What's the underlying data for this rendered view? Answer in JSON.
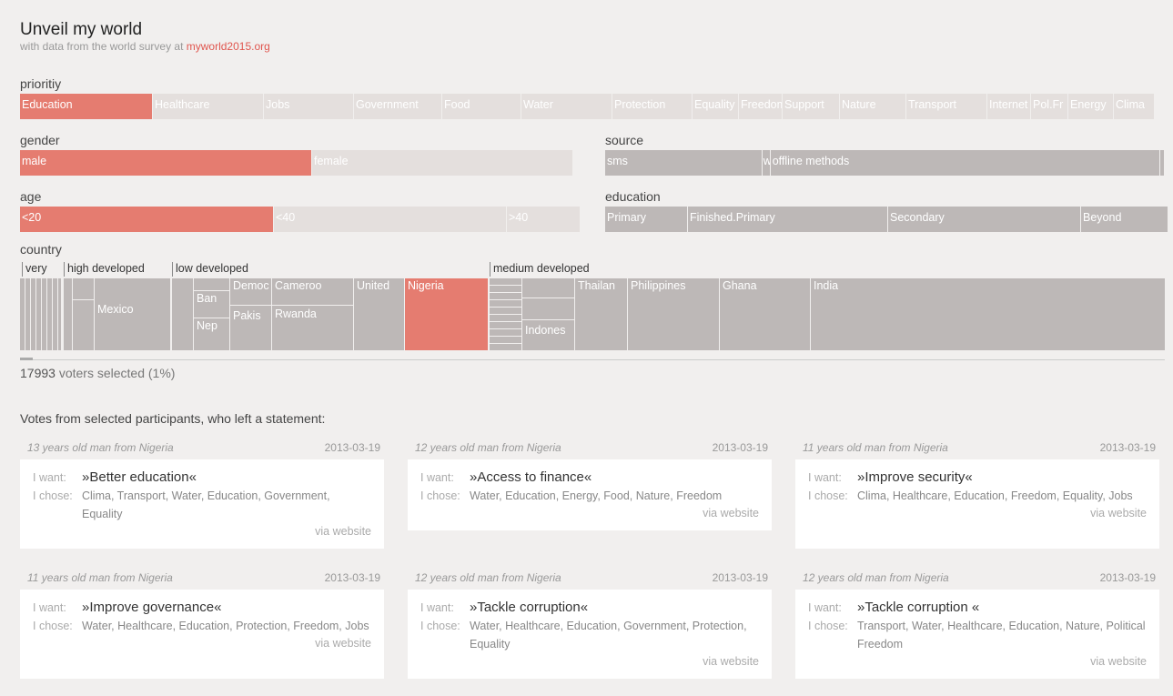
{
  "header": {
    "title": "Unveil my world",
    "subtitle_prefix": "with data from the world survey at ",
    "subtitle_link": "myworld2015.org"
  },
  "priority": {
    "label": "prioritiy",
    "items": [
      "Education",
      "Healthcare",
      "Jobs",
      "Government",
      "Food",
      "Water",
      "Protection",
      "Equality",
      "Freedom",
      "Support",
      "Nature",
      "Transport",
      "Internet",
      "Pol.Fr",
      "Energy",
      "Clima"
    ],
    "selected": "Education"
  },
  "gender": {
    "label": "gender",
    "items": [
      "male",
      "female"
    ],
    "selected": "male"
  },
  "age": {
    "label": "age",
    "items": [
      "<20",
      "<40",
      ">40"
    ],
    "selected": "<20"
  },
  "source": {
    "label": "source",
    "items": [
      "sms",
      "w",
      "offline methods",
      ""
    ]
  },
  "education": {
    "label": "education",
    "items": [
      "Primary",
      "Finished.Primary",
      "Secondary",
      "Beyond"
    ]
  },
  "country": {
    "label": "country",
    "groups": [
      "very",
      "high developed",
      "low developed",
      "medium developed"
    ],
    "cells": [
      "Mexico",
      "Ban",
      "Nep",
      "Democ",
      "Pakis",
      "Cameroo",
      "Rwanda",
      "United",
      "Nigeria",
      "Indones",
      "Thailan",
      "Philippines",
      "Ghana",
      "India"
    ],
    "selected": "Nigeria"
  },
  "selection": {
    "count": "17993",
    "text": " voters selected (1%)"
  },
  "votes": {
    "heading": "Votes from selected participants, who left a statement:",
    "want_label": "I want:",
    "chose_label": "I chose:",
    "cards": [
      {
        "who": "13 years old man from Nigeria",
        "date": "2013-03-19",
        "want": "»Better education«",
        "chose": "Clima, Transport, Water, Education, Government, Equality",
        "via": "via website"
      },
      {
        "who": "12 years old man from Nigeria",
        "date": "2013-03-19",
        "want": "»Access to finance«",
        "chose": "Water, Education, Energy, Food, Nature, Freedom",
        "via": "via website"
      },
      {
        "who": "11 years old man from Nigeria",
        "date": "2013-03-19",
        "want": "»Improve security«",
        "chose": "Clima, Healthcare, Education, Freedom, Equality, Jobs",
        "via": "via website"
      },
      {
        "who": "11 years old man from Nigeria",
        "date": "2013-03-19",
        "want": "»Improve governance«",
        "chose": "Water, Healthcare, Education, Protection, Freedom, Jobs",
        "via": "via website"
      },
      {
        "who": "12 years old man from Nigeria",
        "date": "2013-03-19",
        "want": "»Tackle corruption«",
        "chose": "Water, Healthcare, Education, Government, Protection, Equality",
        "via": "via website"
      },
      {
        "who": "12 years old man from Nigeria",
        "date": "2013-03-19",
        "want": "»Tackle corruption «",
        "chose": "Transport, Water, Healthcare, Education, Nature, Political Freedom",
        "via": "via website"
      }
    ]
  },
  "colors": {
    "selected": "#e57c70",
    "unselected": "#e4dfdd",
    "neutral": "#bdb8b7",
    "link": "#e0564f"
  }
}
